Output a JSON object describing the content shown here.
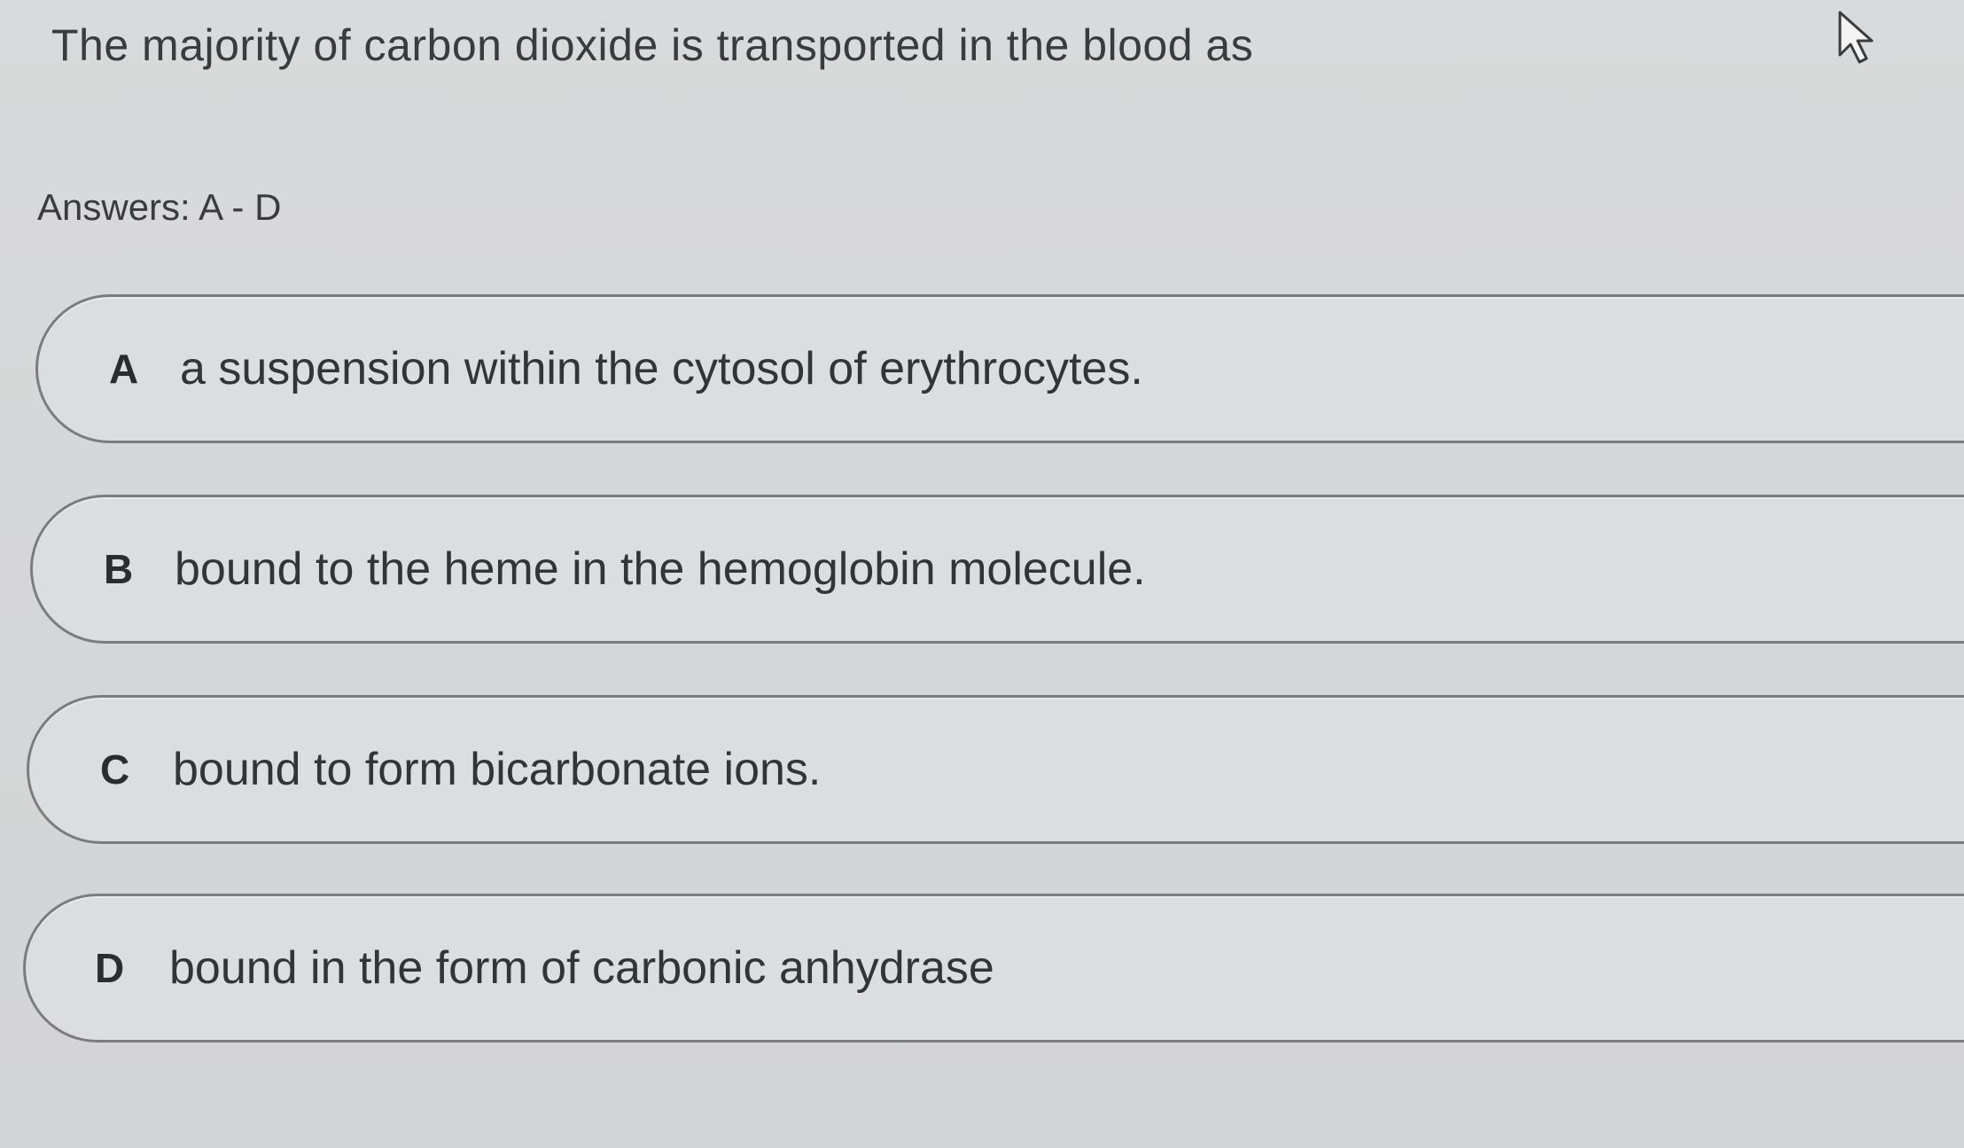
{
  "question": {
    "text": "The majority of carbon dioxide is transported in the blood as"
  },
  "answers_hint": "Answers: A - D",
  "options": [
    {
      "letter": "A",
      "text": "a suspension within the cytosol of erythrocytes."
    },
    {
      "letter": "B",
      "text": "bound to the heme in the hemoglobin molecule."
    },
    {
      "letter": "C",
      "text": "bound to form bicarbonate ions."
    },
    {
      "letter": "D",
      "text": "bound in the form of carbonic anhydrase"
    }
  ],
  "icons": {
    "cursor": "mouse-pointer-icon"
  }
}
